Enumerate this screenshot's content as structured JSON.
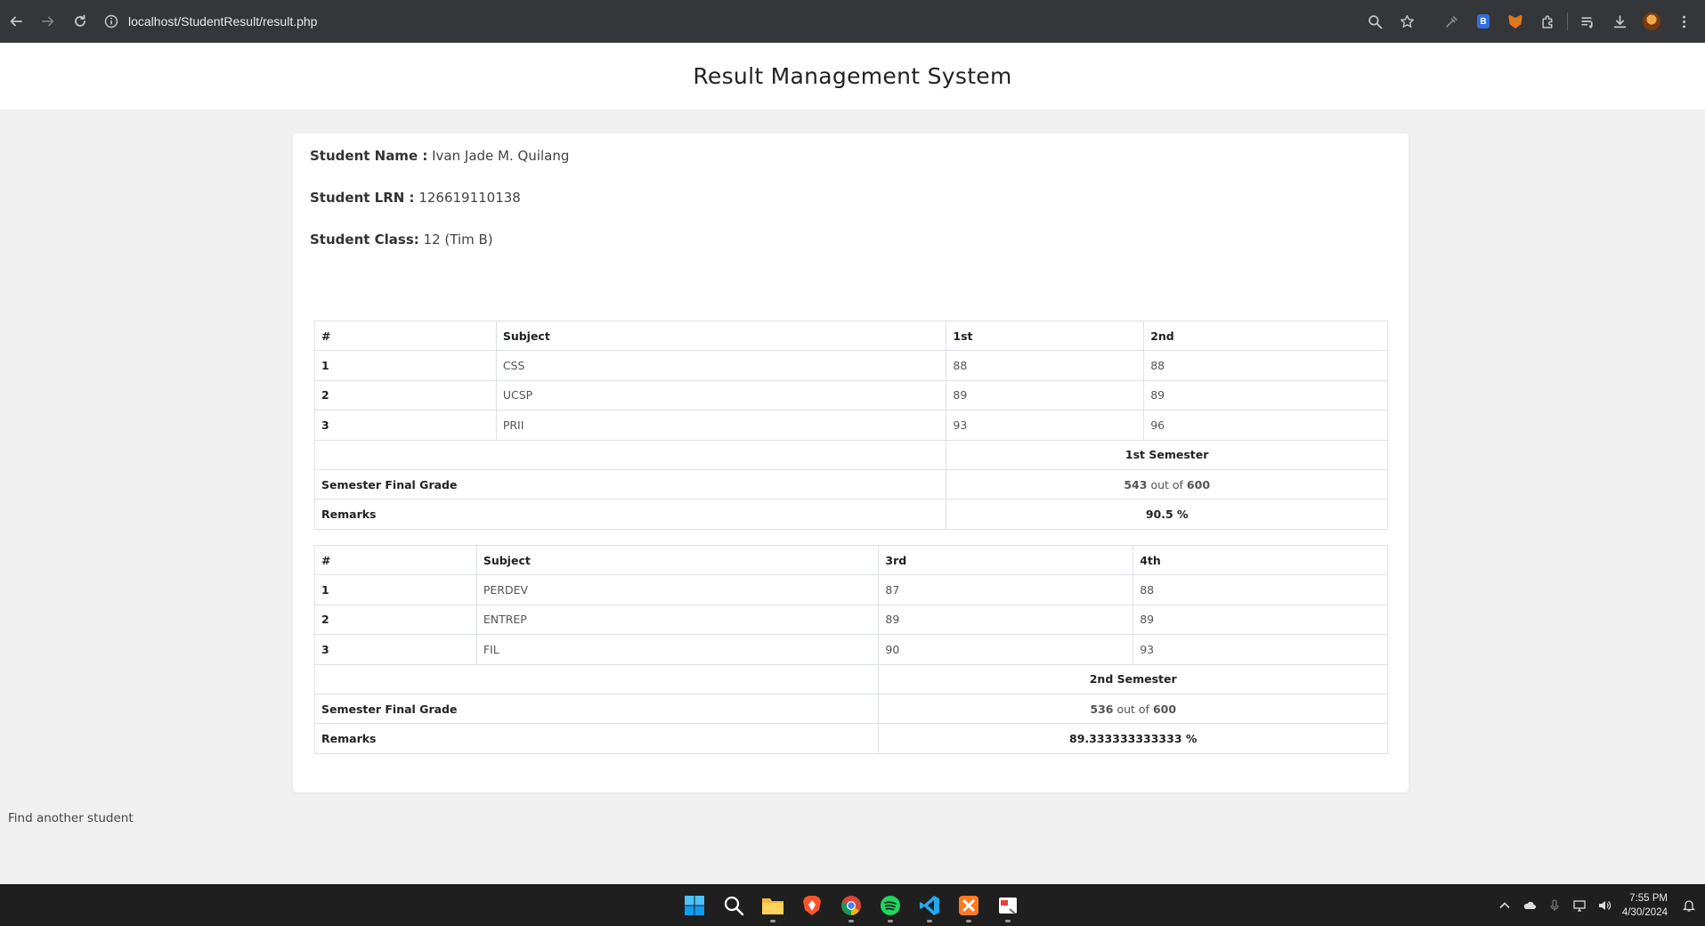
{
  "browser": {
    "url": "localhost/StudentResult/result.php"
  },
  "header": {
    "title": "Result Management System"
  },
  "student": {
    "name_label": "Student Name :",
    "name": "Ivan Jade M. Quilang",
    "lrn_label": "Student LRN :",
    "lrn": "126619110138",
    "class_label": "Student Class:",
    "class": "12 (Tim B)"
  },
  "first_semester": {
    "headers": [
      "#",
      "Subject",
      "1st",
      "2nd"
    ],
    "rows": [
      {
        "num": "1",
        "subject": "CSS",
        "q1": "88",
        "q2": "88"
      },
      {
        "num": "2",
        "subject": "UCSP",
        "q1": "89",
        "q2": "89"
      },
      {
        "num": "3",
        "subject": "PRII",
        "q1": "93",
        "q2": "96"
      }
    ],
    "semester_label": "1st Semester",
    "final_grade_label": "Semester Final Grade",
    "total": "543",
    "out_of_text": "out of",
    "max": "600",
    "remarks_label": "Remarks",
    "remarks": "90.5 %"
  },
  "second_semester": {
    "headers": [
      "#",
      "Subject",
      "3rd",
      "4th"
    ],
    "rows": [
      {
        "num": "1",
        "subject": "PERDEV",
        "q1": "87",
        "q2": "88"
      },
      {
        "num": "2",
        "subject": "ENTREP",
        "q1": "89",
        "q2": "89"
      },
      {
        "num": "3",
        "subject": "FIL",
        "q1": "90",
        "q2": "93"
      }
    ],
    "semester_label": "2nd Semester",
    "final_grade_label": "Semester Final Grade",
    "total": "536",
    "out_of_text": "out of",
    "max": "600",
    "remarks_label": "Remarks",
    "remarks": "89.333333333333 %"
  },
  "footer": {
    "find_link": "Find another student"
  },
  "taskbar": {
    "time": "7:55 PM",
    "date": "4/30/2024",
    "apps": [
      "start-icon",
      "search-icon",
      "file-explorer-icon",
      "brave-icon",
      "chrome-icon",
      "spotify-icon",
      "vscode-icon",
      "xampp-icon",
      "app-icon"
    ]
  }
}
